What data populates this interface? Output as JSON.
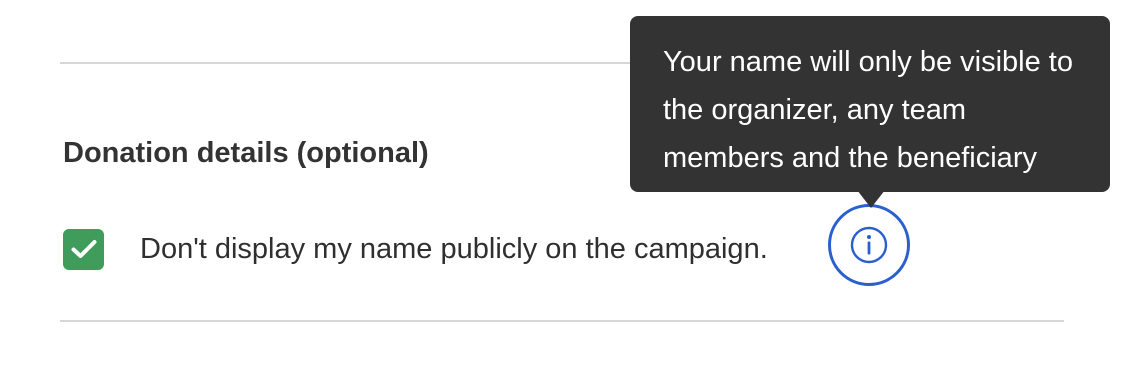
{
  "section": {
    "title": "Donation details (optional)"
  },
  "option": {
    "label": "Don't display my name publicly on the campaign.",
    "checked": true,
    "checkbox_color": "#3f9c5a"
  },
  "info_button": {
    "icon": "info-icon",
    "color": "#2a5fd0"
  },
  "tooltip": {
    "text": "Your name will only be visible to the organizer, any team members and the beneficiary",
    "background": "#333333"
  }
}
